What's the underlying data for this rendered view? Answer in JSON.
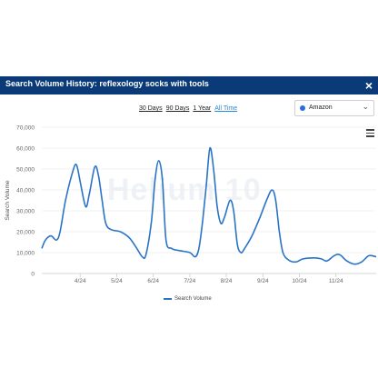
{
  "header": {
    "title": "Search Volume History: reflexology socks with tools",
    "close_label": "×"
  },
  "ranges": [
    {
      "label": "30 Days",
      "active": false
    },
    {
      "label": "90 Days",
      "active": false
    },
    {
      "label": "1 Year",
      "active": false
    },
    {
      "label": "All Time",
      "active": true
    }
  ],
  "marketplace": {
    "value": "Amazon",
    "dot_color": "#2a6fd6"
  },
  "watermark": "Helium 10",
  "chart_data": {
    "type": "line",
    "ylabel": "Search Volume",
    "xlabel": "",
    "ylim": [
      0,
      70000
    ],
    "y_ticks": [
      "0",
      "10,000",
      "20,000",
      "30,000",
      "40,000",
      "50,000",
      "60,000",
      "70,000"
    ],
    "x_ticks": [
      {
        "label": "4/24",
        "x": 4.5
      },
      {
        "label": "5/24",
        "x": 5.5
      },
      {
        "label": "6/24",
        "x": 6.5
      },
      {
        "label": "7/24",
        "x": 7.5
      },
      {
        "label": "8/24",
        "x": 8.5
      },
      {
        "label": "9/24",
        "x": 9.5
      },
      {
        "label": "10/24",
        "x": 10.5
      },
      {
        "label": "11/24",
        "x": 11.5
      }
    ],
    "x_range": [
      3.45,
      12.6
    ],
    "grid": true,
    "legend": "bottom",
    "series": [
      {
        "name": "Search Volume",
        "color": "#2a74c8",
        "points": [
          [
            3.45,
            12000
          ],
          [
            3.55,
            16000
          ],
          [
            3.7,
            18000
          ],
          [
            3.85,
            16000
          ],
          [
            3.95,
            20000
          ],
          [
            4.1,
            35000
          ],
          [
            4.3,
            49000
          ],
          [
            4.4,
            52000
          ],
          [
            4.5,
            44000
          ],
          [
            4.65,
            32000
          ],
          [
            4.75,
            38000
          ],
          [
            4.9,
            51000
          ],
          [
            5.0,
            47000
          ],
          [
            5.1,
            35000
          ],
          [
            5.2,
            24000
          ],
          [
            5.35,
            21000
          ],
          [
            5.6,
            20000
          ],
          [
            5.85,
            17000
          ],
          [
            6.05,
            12000
          ],
          [
            6.2,
            8000
          ],
          [
            6.3,
            9000
          ],
          [
            6.45,
            25000
          ],
          [
            6.55,
            45000
          ],
          [
            6.65,
            54000
          ],
          [
            6.75,
            45000
          ],
          [
            6.85,
            16000
          ],
          [
            7.0,
            12000
          ],
          [
            7.2,
            11000
          ],
          [
            7.5,
            10000
          ],
          [
            7.65,
            8000
          ],
          [
            7.75,
            12000
          ],
          [
            7.85,
            25000
          ],
          [
            7.95,
            42000
          ],
          [
            8.05,
            60000
          ],
          [
            8.15,
            50000
          ],
          [
            8.25,
            32000
          ],
          [
            8.35,
            24000
          ],
          [
            8.45,
            27000
          ],
          [
            8.6,
            35000
          ],
          [
            8.7,
            30000
          ],
          [
            8.8,
            14000
          ],
          [
            8.9,
            10000
          ],
          [
            9.0,
            12000
          ],
          [
            9.2,
            18000
          ],
          [
            9.4,
            26000
          ],
          [
            9.6,
            35000
          ],
          [
            9.75,
            40000
          ],
          [
            9.85,
            35000
          ],
          [
            9.95,
            20000
          ],
          [
            10.05,
            10000
          ],
          [
            10.2,
            6500
          ],
          [
            10.4,
            5500
          ],
          [
            10.6,
            7000
          ],
          [
            10.9,
            7500
          ],
          [
            11.1,
            7000
          ],
          [
            11.25,
            6000
          ],
          [
            11.45,
            8500
          ],
          [
            11.6,
            9000
          ],
          [
            11.8,
            6000
          ],
          [
            12.0,
            4500
          ],
          [
            12.2,
            5500
          ],
          [
            12.4,
            8500
          ],
          [
            12.6,
            8000
          ]
        ]
      }
    ]
  }
}
